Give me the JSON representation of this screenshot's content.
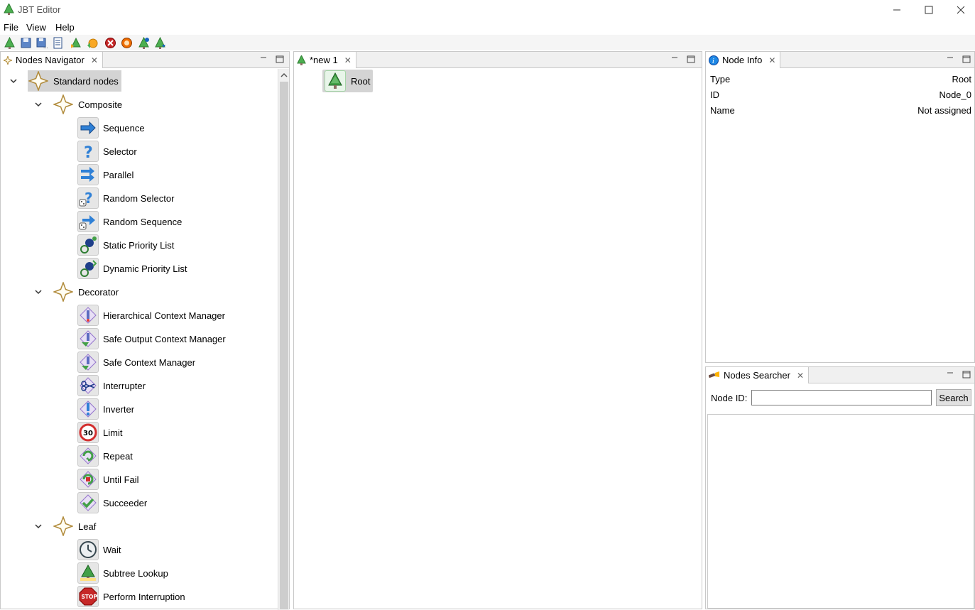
{
  "window": {
    "title": "JBT Editor"
  },
  "menu": {
    "items": [
      "File",
      "View",
      "Help"
    ]
  },
  "navigator": {
    "tab_label": "Nodes Navigator",
    "root_label": "Standard nodes",
    "groups": [
      {
        "label": "Composite",
        "items": [
          "Sequence",
          "Selector",
          "Parallel",
          "Random Selector",
          "Random Sequence",
          "Static Priority List",
          "Dynamic Priority List"
        ]
      },
      {
        "label": "Decorator",
        "items": [
          "Hierarchical Context Manager",
          "Safe Output Context Manager",
          "Safe Context Manager",
          "Interrupter",
          "Inverter",
          "Limit",
          "Repeat",
          "Until Fail",
          "Succeeder"
        ]
      },
      {
        "label": "Leaf",
        "items": [
          "Wait",
          "Subtree Lookup",
          "Perform Interruption"
        ]
      }
    ]
  },
  "editor": {
    "tab_label": "*new 1",
    "root_node_label": "Root"
  },
  "node_info": {
    "tab_label": "Node Info",
    "rows": [
      {
        "key": "Type",
        "value": "Root"
      },
      {
        "key": "ID",
        "value": "Node_0"
      },
      {
        "key": "Name",
        "value": "Not assigned"
      }
    ]
  },
  "searcher": {
    "tab_label": "Nodes Searcher",
    "field_label": "Node ID:",
    "field_value": "",
    "button_label": "Search"
  }
}
